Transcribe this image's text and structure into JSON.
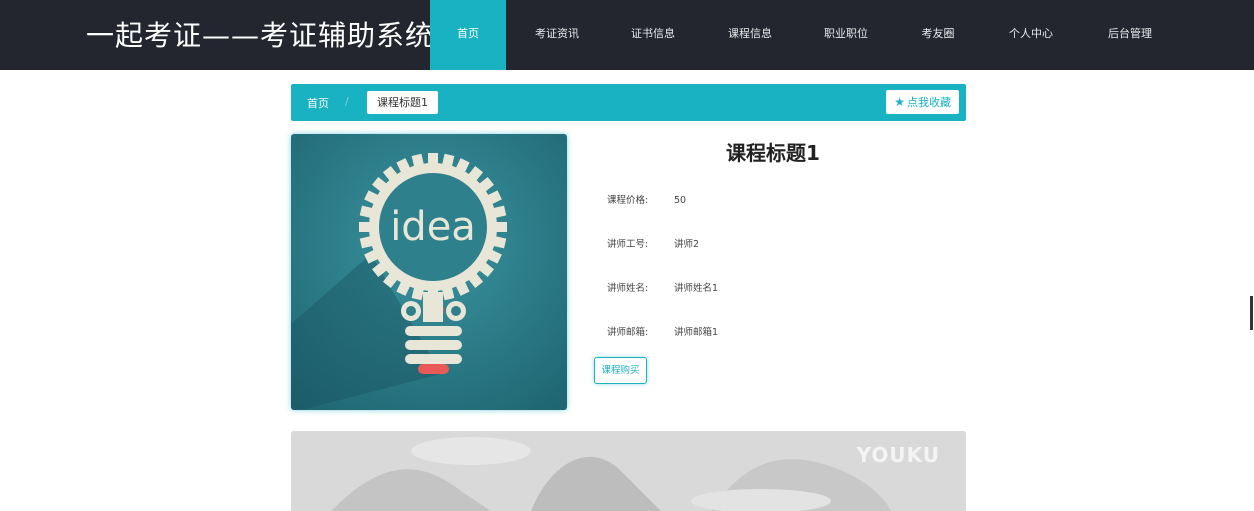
{
  "header": {
    "site_title": "一起考证——考证辅助系统",
    "nav": [
      {
        "label": "首页",
        "active": true
      },
      {
        "label": "考证资讯"
      },
      {
        "label": "证书信息"
      },
      {
        "label": "课程信息"
      },
      {
        "label": "职业职位"
      },
      {
        "label": "考友圈"
      },
      {
        "label": "个人中心"
      },
      {
        "label": "后台管理"
      }
    ]
  },
  "breadcrumb": {
    "home": "首页",
    "separator": "/",
    "current": "课程标题1",
    "favorite_label": "点我收藏",
    "favorite_icon": "star-icon"
  },
  "course": {
    "image_text": "idea",
    "title": "课程标题1",
    "fields": [
      {
        "label": "课程价格:",
        "value": "50"
      },
      {
        "label": "讲师工号:",
        "value": "讲师2"
      },
      {
        "label": "讲师姓名:",
        "value": "讲师姓名1"
      },
      {
        "label": "讲师邮箱:",
        "value": "讲师邮箱1"
      }
    ],
    "buy_label": "课程购买"
  },
  "video": {
    "logo_text": "YOUKU"
  },
  "colors": {
    "header_bg": "#23262f",
    "accent": "#19b2c3",
    "image_bg": "#2e7f8c",
    "gear": "#e8e6d6",
    "bulb_red": "#e85a55"
  }
}
